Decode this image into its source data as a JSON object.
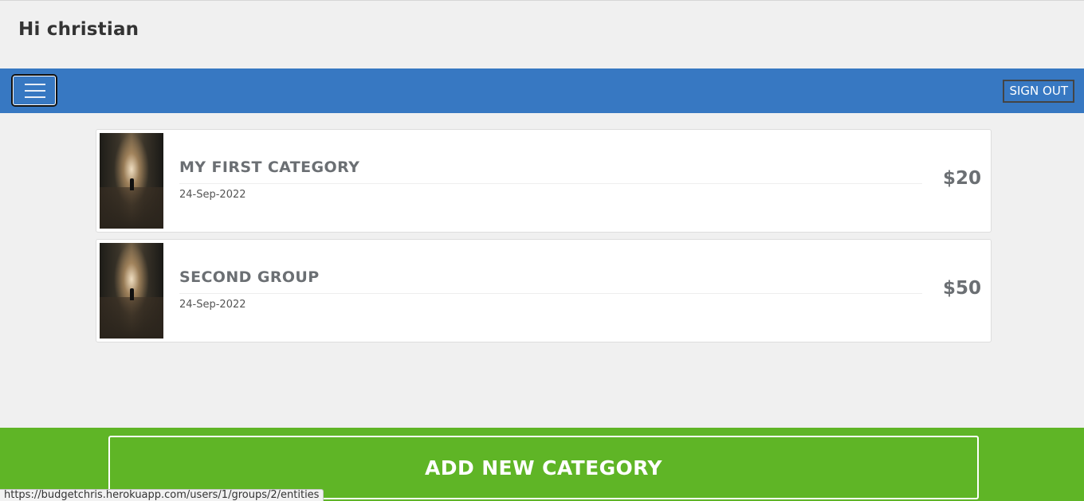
{
  "header": {
    "greeting": "Hi christian"
  },
  "navbar": {
    "menu_icon": "hamburger-menu-icon",
    "sign_out_label": "SIGN OUT"
  },
  "categories": [
    {
      "name": "MY FIRST CATEGORY",
      "date": "24-Sep-2022",
      "amount": "$20"
    },
    {
      "name": "SECOND GROUP",
      "date": "24-Sep-2022",
      "amount": "$50"
    }
  ],
  "footer": {
    "add_label": "ADD NEW CATEGORY"
  },
  "status_bar": {
    "url": "https://budgetchris.herokuapp.com/users/1/groups/2/entities"
  },
  "colors": {
    "navbar": "#3778c2",
    "footer": "#5fb526",
    "background": "#f0f0f0"
  }
}
